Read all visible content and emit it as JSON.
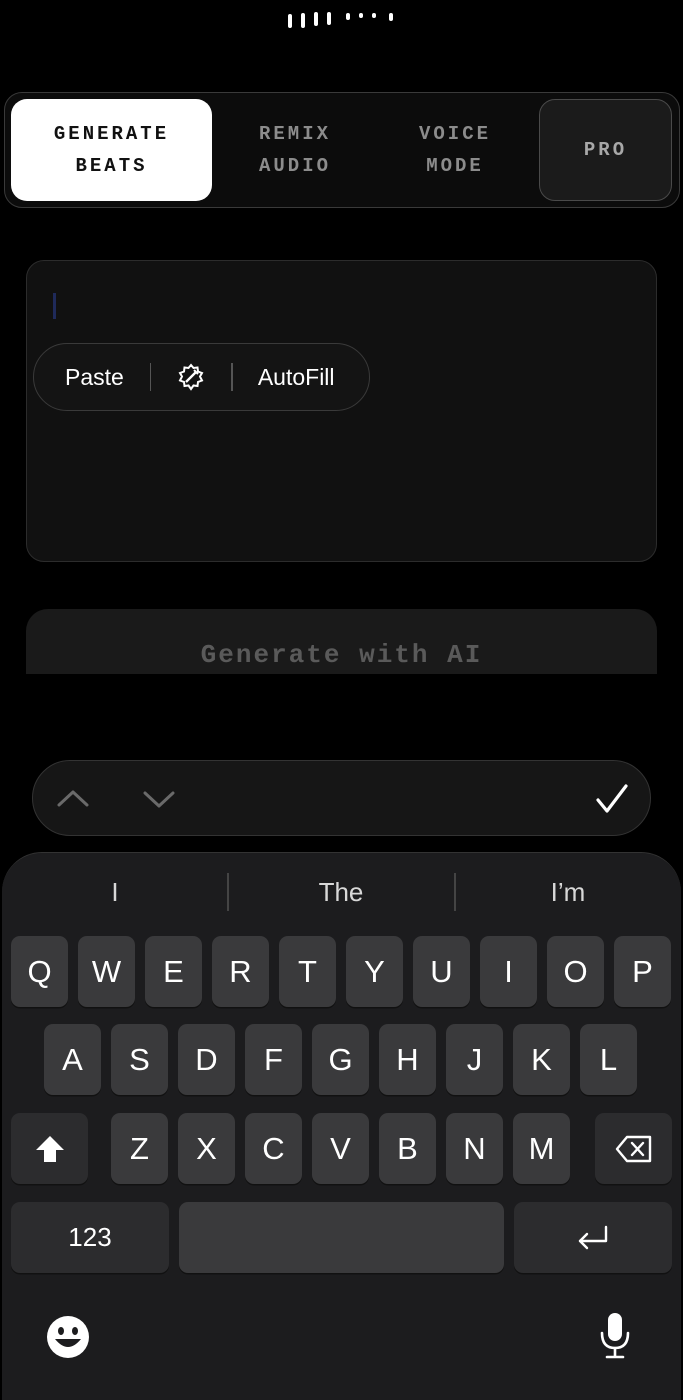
{
  "tabs": [
    {
      "label": "GENERATE\nBEATS",
      "active": true
    },
    {
      "label": "REMIX\nAUDIO",
      "active": false
    },
    {
      "label": "VOICE\nMODE",
      "active": false
    },
    {
      "label": "PRO",
      "active": false
    }
  ],
  "edit_menu": {
    "paste": "Paste",
    "autofill": "AutoFill",
    "middle_icon": "writing-tools-icon"
  },
  "generate_button": "Generate with AI",
  "accessory": {
    "up_icon": "chevron-up-icon",
    "down_icon": "chevron-down-icon",
    "done_icon": "checkmark-icon"
  },
  "keyboard": {
    "suggestions": [
      "I",
      "The",
      "I’m"
    ],
    "row1": [
      "Q",
      "W",
      "E",
      "R",
      "T",
      "Y",
      "U",
      "I",
      "O",
      "P"
    ],
    "row2": [
      "A",
      "S",
      "D",
      "F",
      "G",
      "H",
      "J",
      "K",
      "L"
    ],
    "row3": [
      "Z",
      "X",
      "C",
      "V",
      "B",
      "N",
      "M"
    ],
    "numbers_key": "123",
    "shift_icon": "shift-icon",
    "delete_icon": "delete-icon",
    "return_icon": "return-icon",
    "emoji_icon": "emoji-icon",
    "mic_icon": "microphone-icon"
  }
}
